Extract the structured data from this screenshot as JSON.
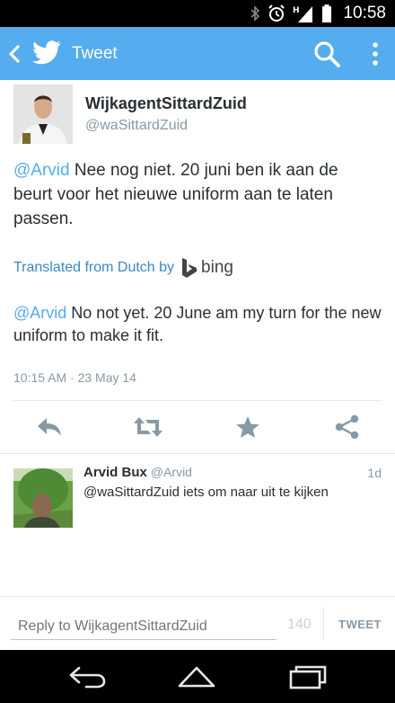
{
  "status_bar": {
    "time": "10:58",
    "icons": [
      "bluetooth-icon",
      "alarm-icon",
      "signal-icon",
      "battery-icon"
    ],
    "network": "H"
  },
  "action_bar": {
    "title": "Tweet",
    "color": "#55acee"
  },
  "tweet": {
    "author_name": "WijkagentSittardZuid",
    "author_handle": "@waSittardZuid",
    "mention": "@Arvid",
    "text": " Nee nog niet. 20 juni ben ik aan de beurt voor het nieuwe uniform aan te laten passen.",
    "translated_from": "Translated from Dutch by",
    "translator": "bing",
    "translation_mention": "@Arvid",
    "translation_text": " No not yet. 20 June am my turn for the new uniform to make it fit.",
    "timestamp": "10:15 AM · 23 May 14"
  },
  "actions": [
    "reply-icon",
    "retweet-icon",
    "favorite-icon",
    "share-icon"
  ],
  "reply": {
    "name": "Arvid Bux",
    "handle": "@Arvid",
    "time": "1d",
    "text": "@waSittardZuid iets om naar uit te kijken"
  },
  "compose": {
    "placeholder": "Reply to WijkagentSittardZuid",
    "count": "140",
    "button": "TWEET"
  },
  "nav": [
    "back-nav-icon",
    "home-nav-icon",
    "recents-nav-icon"
  ]
}
